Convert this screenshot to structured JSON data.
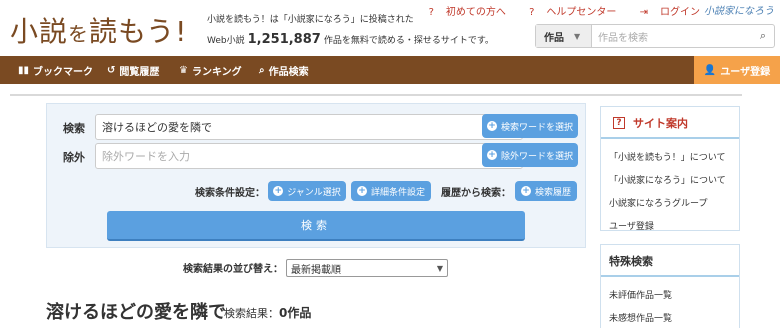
{
  "header": {
    "logo_main": "小説",
    "logo_small": "を",
    "logo_end": "読もう!",
    "tagline": "小説を読もう！は「小説家になろう」に投稿された",
    "tagline2_prefix": "Web小説",
    "novel_count": "1,251,887",
    "tagline2_suffix": "作品を無料で読める・探せるサイトです。",
    "links": {
      "first_time": "初めての方へ",
      "help": "ヘルプセンター",
      "login": "ログイン"
    },
    "brand_small": "小説家になろう",
    "search": {
      "select_value": "作品",
      "placeholder": "作品を検索"
    }
  },
  "nav": {
    "bookmark": "ブックマーク",
    "history": "閲覧履歴",
    "ranking": "ランキング",
    "search": "作品検索",
    "register": "ユーザ登録"
  },
  "search_panel": {
    "keyword_label": "検索",
    "keyword_value": "溶けるほどの愛を隣で",
    "keyword_button": "検索ワードを選択",
    "exclude_label": "除外",
    "exclude_placeholder": "除外ワードを入力",
    "exclude_button": "除外ワードを選択",
    "condition_label": "検索条件設定：",
    "genre_button": "ジャンル選択",
    "detail_button": "詳細条件設定",
    "history_label": "履歴から検索：",
    "history_button": "検索履歴",
    "submit_label": "検索"
  },
  "sort": {
    "label": "検索結果の並び替え：",
    "selected": "最新掲載順"
  },
  "results": {
    "title": "溶けるほどの愛を隣で",
    "meta_label": "検索結果：",
    "count": "0作品"
  },
  "sidebar": {
    "guide_title": "サイト案内",
    "guide_items": [
      "「小説を読もう！」について",
      "「小説家になろう」について",
      "小説家になろうグループ",
      "ユーザ登録"
    ],
    "special_title": "特殊検索",
    "special_items": [
      "未評価作品一覧",
      "未感想作品一覧"
    ]
  },
  "colors": {
    "brand_brown": "#7a4a22",
    "accent_orange": "#f5a24a",
    "button_blue": "#5ba0e0",
    "link_red": "#c0392b"
  }
}
